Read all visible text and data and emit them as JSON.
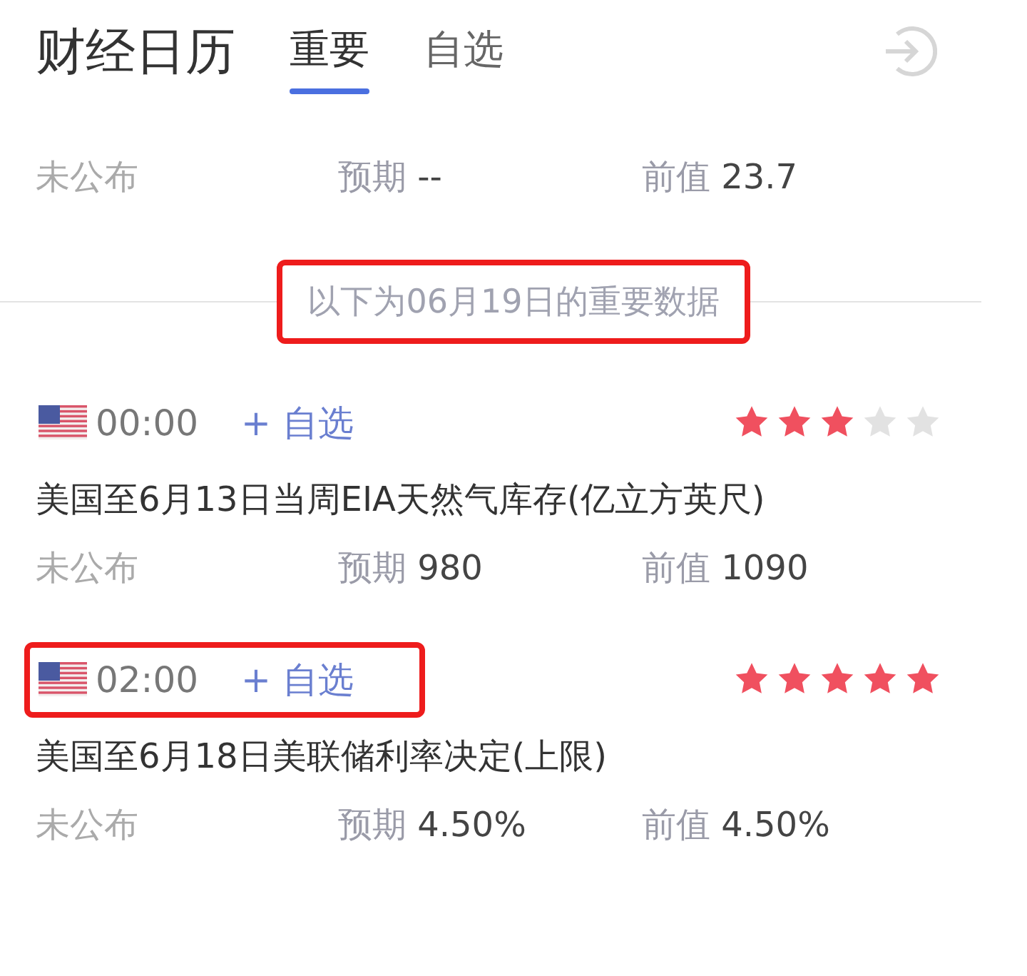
{
  "header": {
    "title": "财经日历",
    "tabs": [
      {
        "label": "重要",
        "selected": true
      },
      {
        "label": "自选",
        "selected": false
      }
    ]
  },
  "previous_event": {
    "status": "未公布",
    "forecast_label": "预期",
    "forecast": "--",
    "previous_label": "前值",
    "previous": "23.7"
  },
  "separator": {
    "text": "以下为06月19日的重要数据",
    "highlighted": true
  },
  "events": [
    {
      "time": "00:00",
      "watch": "+ 自选",
      "stars": 3,
      "title": "美国至6月13日当周EIA天然气库存(亿立方英尺)",
      "status": "未公布",
      "forecast_label": "预期",
      "forecast": "980",
      "previous_label": "前值",
      "previous": "1090",
      "highlighted": false
    },
    {
      "time": "02:00",
      "watch": "+ 自选",
      "stars": 5,
      "title": "美国至6月18日美联储利率决定(上限)",
      "status": "未公布",
      "forecast_label": "预期",
      "forecast": "4.50%",
      "previous_label": "前值",
      "previous": "4.50%",
      "highlighted": true
    }
  ]
}
